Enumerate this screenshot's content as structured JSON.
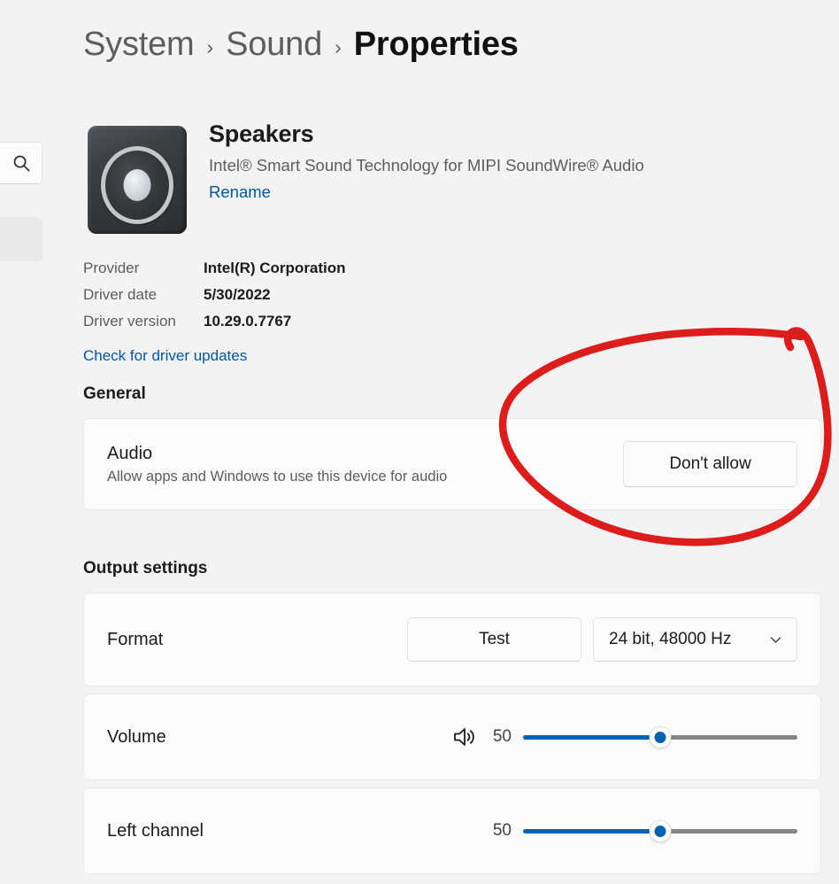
{
  "left_rail": {
    "search_icon": "search-icon",
    "selected_item": "sidebar-selected-item"
  },
  "breadcrumb": {
    "items": [
      {
        "label": "System",
        "current": false
      },
      {
        "label": "Sound",
        "current": false
      },
      {
        "label": "Properties",
        "current": true
      }
    ],
    "separator": "›"
  },
  "device": {
    "icon": "speaker-device-icon",
    "name": "Speakers",
    "description": "Intel® Smart Sound Technology for MIPI SoundWire® Audio",
    "rename_label": "Rename"
  },
  "driver": {
    "rows": [
      {
        "label": "Provider",
        "value": "Intel(R) Corporation"
      },
      {
        "label": "Driver date",
        "value": "5/30/2022"
      },
      {
        "label": "Driver version",
        "value": "10.29.0.7767"
      }
    ],
    "update_link_label": "Check for driver updates"
  },
  "general": {
    "title": "General",
    "audio": {
      "label": "Audio",
      "description": "Allow apps and Windows to use this device for audio",
      "button_label": "Don't allow"
    }
  },
  "output_settings": {
    "title": "Output settings",
    "format": {
      "label": "Format",
      "test_button_label": "Test",
      "selected_option": "24 bit, 48000 Hz",
      "chevron_icon": "chevron-down-icon"
    },
    "volume": {
      "label": "Volume",
      "icon": "speaker-volume-icon",
      "value": "50",
      "percent": 50
    },
    "left_channel": {
      "label": "Left channel",
      "value": "50",
      "percent": 50
    }
  },
  "annotation": {
    "type": "hand-drawn-ellipse",
    "color": "#DD1C1C",
    "target": "Don't allow"
  },
  "colors": {
    "page_background": "#F3F3F3",
    "card_background": "#FBFBFB",
    "accent_blue": "#0063B1",
    "link_blue": "#0056A8",
    "annotation_red": "#DD1C1C"
  }
}
